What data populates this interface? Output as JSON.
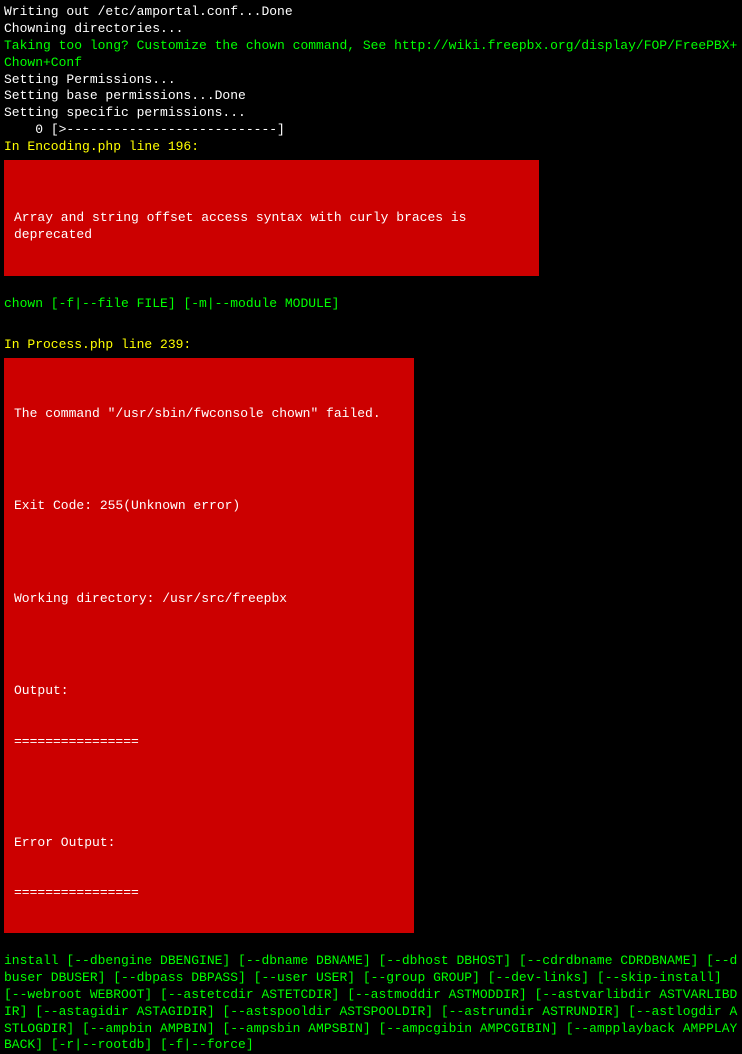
{
  "lines": {
    "l1": "Writing out /etc/amportal.conf...Done",
    "l2": "Chowning directories...",
    "l3": "Taking too long? Customize the chown command, See http://wiki.freepbx.org/display/FOP/FreePBX+Chown+Conf",
    "l4": "Setting Permissions...",
    "l5": "Setting base permissions...Done",
    "l6": "Setting specific permissions...",
    "l7": "    0 [>---------------------------]",
    "l8": "In Encoding.php line 196:",
    "l9": "chown [-f|--file FILE] [-m|--module MODULE]",
    "l10": "In Process.php line 239:",
    "l11": "install [--dbengine DBENGINE] [--dbname DBNAME] [--dbhost DBHOST] [--cdrdbname CDRDBNAME] [--dbuser DBUSER] [--dbpass DBPASS] [--user USER] [--group GROUP] [--dev-links] [--skip-install] [--webroot WEBROOT] [--astetcdir ASTETCDIR] [--astmoddir ASTMODDIR] [--astvarlibdir ASTVARLIBDIR] [--astagidir ASTAGIDIR] [--astspooldir ASTSPOOLDIR] [--astrundir ASTRUNDIR] [--astlogdir ASTLOGDIR] [--ampbin AMPBIN] [--ampsbin AMPSBIN] [--ampcgibin AMPCGIBIN] [--ampplayback AMPPLAYBACK] [-r|--rootdb] [-f|--force]"
  },
  "error1": "Array and string offset access syntax with curly braces is deprecated",
  "error2": {
    "e1": "The command \"/usr/sbin/fwconsole chown\" failed.",
    "e2": "Exit Code: 255(Unknown error)",
    "e3": "Working directory: /usr/src/freepbx",
    "e4": "Output:",
    "e5": "================",
    "e6": "Error Output:",
    "e7": "================"
  }
}
